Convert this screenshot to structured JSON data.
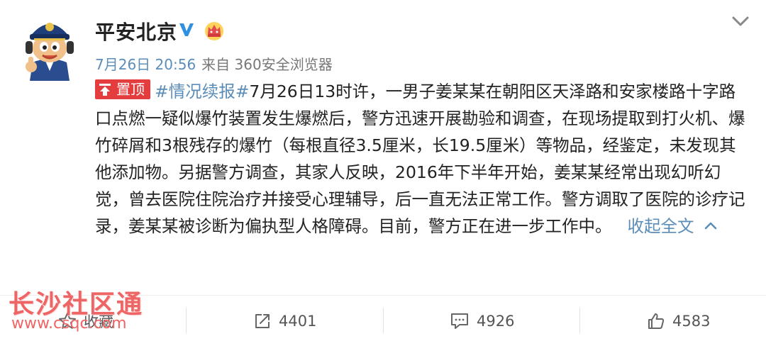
{
  "post": {
    "username": "平安北京",
    "date": "7月26日 20:56",
    "source_prefix": "来自",
    "source": "360安全浏览器",
    "pin_label": "置顶",
    "hashtag": "#情况续报#",
    "body": "7月26日13时许，一男子姜某某在朝阳区天泽路和安家楼路十字路口点燃一疑似爆竹装置发生爆燃后，警方迅速开展勘验和调查，在现场提取到打火机、爆竹碎屑和3根残存的爆竹（每根直径3.5厘米，长19.5厘米）等物品，经鉴定，未发现其他添加物。另据警方调查，其家人反映，2016年下半年开始，姜某某经常出现幻听幻觉，曾去医院住院治疗并接受心理辅导，后一直无法正常工作。警方调取了医院的诊疗记录，姜某某被诊断为偏执型人格障碍。目前，警方正在进一步工作中。",
    "collapse_label": "收起全文"
  },
  "actions": {
    "favorite_label": "收藏",
    "repost_count": "4401",
    "comment_count": "4926",
    "like_count": "4583"
  },
  "watermark": {
    "title": "长沙社区通",
    "url": "www.csqc.com"
  },
  "colors": {
    "link": "#5b8db8",
    "pin_badge": "#e43d3d",
    "verified": "#2f8fe0",
    "watermark": "#ee6565"
  },
  "icons": {
    "avatar": "police-cartoon-avatar",
    "verified": "verified-v-icon",
    "crown": "vip-crown-icon",
    "menu": "chevron-down-icon",
    "pin": "pin-top-icon",
    "collapse": "chevron-up-icon",
    "favorite": "star-icon",
    "repost": "repost-icon",
    "comment": "comment-icon",
    "like": "thumbs-up-icon"
  }
}
